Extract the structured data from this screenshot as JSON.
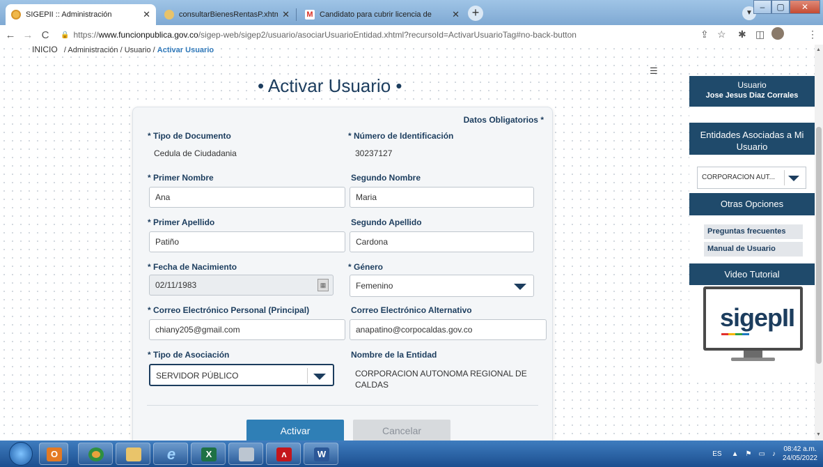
{
  "browser": {
    "tabs": [
      {
        "title": "SIGEPII :: Administración",
        "active": true
      },
      {
        "title": "consultarBienesRentasP.xhtml",
        "active": false
      },
      {
        "title": "Candidato para cubrir licencia de",
        "active": false
      }
    ],
    "url_scheme": "https://",
    "url_host": "www.funcionpublica.gov.co",
    "url_path": "/sigep-web/sigep2/usuario/asociarUsuarioEntidad.xhtml?recursoId=ActivarUsuarioTag#no-back-button"
  },
  "breadcrumb": {
    "home": "INICIO",
    "sep": "/",
    "item1": "Administración",
    "item2": "Usuario",
    "current": "Activar Usuario"
  },
  "page_title": "• Activar Usuario •",
  "form": {
    "required_note": "Datos Obligatorios *",
    "tipo_documento": {
      "label": "* Tipo de Documento",
      "value": "Cedula de Ciudadania"
    },
    "numero_identificacion": {
      "label": "* Número de Identificación",
      "value": "30237127"
    },
    "primer_nombre": {
      "label": "* Primer Nombre",
      "value": "Ana"
    },
    "segundo_nombre": {
      "label": "Segundo Nombre",
      "value": "Maria"
    },
    "primer_apellido": {
      "label": "* Primer Apellido",
      "value": "Patiño"
    },
    "segundo_apellido": {
      "label": "Segundo Apellido",
      "value": "Cardona"
    },
    "fecha_nacimiento": {
      "label": "* Fecha de Nacimiento",
      "value": "02/11/1983"
    },
    "genero": {
      "label": "* Género",
      "value": "Femenino"
    },
    "correo_personal": {
      "label": "* Correo Electrónico Personal (Principal)",
      "value": "chiany205@gmail.com"
    },
    "correo_alternativo": {
      "label": "Correo Electrónico Alternativo",
      "value": "anapatino@corpocaldas.gov.co"
    },
    "tipo_asociacion": {
      "label": "* Tipo de Asociación",
      "value": "SERVIDOR PÚBLICO"
    },
    "nombre_entidad": {
      "label": "Nombre de la Entidad",
      "value_line1": "CORPORACION AUTONOMA REGIONAL DE",
      "value_line2": "CALDAS"
    },
    "activar_label": "Activar",
    "cancelar_label": "Cancelar"
  },
  "sidebar": {
    "usuario_title": "Usuario",
    "usuario_name": "Jose Jesus Diaz Corrales",
    "entidades_title_1": "Entidades Asociadas a Mi",
    "entidades_title_2": "Usuario",
    "entidad_selected": "CORPORACION AUT...",
    "otras_opciones": "Otras Opciones",
    "links": [
      "Preguntas frecuentes",
      "Manual de Usuario"
    ],
    "video_tutorial": "Video Tutorial",
    "video_logo_text": "sigepII"
  },
  "taskbar": {
    "lang": "ES",
    "time": "08:42 a.m.",
    "date": "24/05/2022",
    "colors": {
      "chrome": "#e8a23c",
      "excel": "#1e7145",
      "acrobat": "#c4161c",
      "word": "#2b5797"
    }
  }
}
